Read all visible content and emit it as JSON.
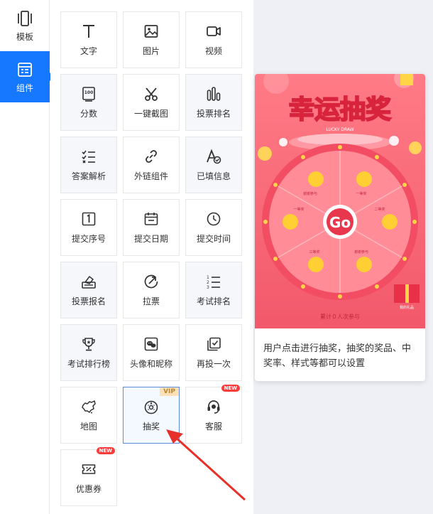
{
  "rail": {
    "items": [
      {
        "label": "模板",
        "icon": "template-icon",
        "active": false
      },
      {
        "label": "组件",
        "icon": "component-icon",
        "active": true
      }
    ]
  },
  "components": [
    {
      "label": "文字",
      "icon": "text-icon"
    },
    {
      "label": "图片",
      "icon": "image-icon"
    },
    {
      "label": "视频",
      "icon": "video-icon"
    },
    {
      "label": "分数",
      "icon": "score-icon"
    },
    {
      "label": "一键截图",
      "icon": "scissors-icon"
    },
    {
      "label": "投票排名",
      "icon": "bar-chart-icon"
    },
    {
      "label": "答案解析",
      "icon": "checklist-icon"
    },
    {
      "label": "外链组件",
      "icon": "link-icon"
    },
    {
      "label": "已填信息",
      "icon": "filled-info-icon"
    },
    {
      "label": "提交序号",
      "icon": "number-one-icon"
    },
    {
      "label": "提交日期",
      "icon": "calendar-icon"
    },
    {
      "label": "提交时间",
      "icon": "clock-icon"
    },
    {
      "label": "投票报名",
      "icon": "ballot-box-icon"
    },
    {
      "label": "拉票",
      "icon": "canvass-icon"
    },
    {
      "label": "考试排名",
      "icon": "numbered-list-icon"
    },
    {
      "label": "考试排行榜",
      "icon": "trophy-icon"
    },
    {
      "label": "头像和昵称",
      "icon": "avatar-icon"
    },
    {
      "label": "再投一次",
      "icon": "revote-icon"
    },
    {
      "label": "地图",
      "icon": "map-icon"
    },
    {
      "label": "抽奖",
      "icon": "lottery-wheel-icon",
      "badge": "VIP"
    },
    {
      "label": "客服",
      "icon": "headset-icon",
      "badge": "NEW"
    },
    {
      "label": "优惠券",
      "icon": "coupon-icon",
      "badge": "NEW"
    }
  ],
  "preview": {
    "banner_title": "幸运抽奖",
    "banner_subtitle": "LUCKY DRAW",
    "wheel_center": "Go",
    "wheel_segments": [
      "谢谢参与",
      "一等奖",
      "二等奖",
      "谢谢参与",
      "三等奖",
      "一等奖"
    ],
    "participants": "累计０人次参与",
    "gift_label": "我的礼品",
    "description": "用户点击进行抽奖，抽奖的奖品、中奖率、样式等都可以设置"
  },
  "colors": {
    "accent": "#1677ff",
    "arrow": "#e8302a"
  }
}
